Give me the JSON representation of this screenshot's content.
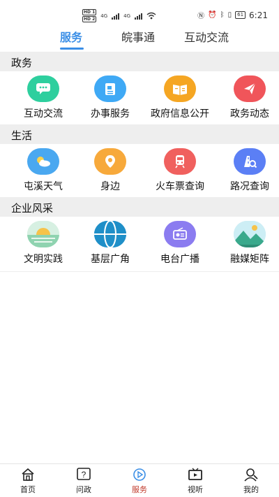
{
  "status_bar": {
    "sim1": "HD 1",
    "sim2": "HD 2",
    "net1": "4G",
    "net2": "4G",
    "battery": "61",
    "time": "6:21"
  },
  "top_tabs": [
    {
      "label": "服务",
      "active": true
    },
    {
      "label": "皖事通",
      "active": false
    },
    {
      "label": "互动交流",
      "active": false
    }
  ],
  "sections": [
    {
      "title": "政务",
      "items": [
        {
          "label": "互动交流",
          "icon": "chat-icon",
          "color": "#2ecf9e"
        },
        {
          "label": "办事服务",
          "icon": "document-icon",
          "color": "#3fa9f5"
        },
        {
          "label": "政府信息公开",
          "icon": "open-book-icon",
          "color": "#f5a623"
        },
        {
          "label": "政务动态",
          "icon": "paper-plane-icon",
          "color": "#f0555a"
        }
      ]
    },
    {
      "title": "生活",
      "items": [
        {
          "label": "屯溪天气",
          "icon": "weather-icon",
          "color": "#4aa8f0"
        },
        {
          "label": "身边",
          "icon": "location-pin-icon",
          "color": "#f7a93b"
        },
        {
          "label": "火车票查询",
          "icon": "train-icon",
          "color": "#f0605e"
        },
        {
          "label": "路况查询",
          "icon": "road-search-icon",
          "color": "#5b7ff5"
        }
      ]
    },
    {
      "title": "企业风采",
      "items": [
        {
          "label": "文明实践",
          "icon": "sunrise-icon",
          "color": "#8fd3b0"
        },
        {
          "label": "基层广角",
          "icon": "globe-icon",
          "color": "#1f8fc8"
        },
        {
          "label": "电台广播",
          "icon": "radio-icon",
          "color": "#8b7cf0"
        },
        {
          "label": "融媒矩阵",
          "icon": "mountain-icon",
          "color": "#6fc4d8"
        }
      ]
    }
  ],
  "bottom_nav": [
    {
      "label": "首页",
      "icon": "home-icon",
      "active": false
    },
    {
      "label": "问政",
      "icon": "question-icon",
      "active": false
    },
    {
      "label": "服务",
      "icon": "service-play-icon",
      "active": true
    },
    {
      "label": "视听",
      "icon": "tv-icon",
      "active": false
    },
    {
      "label": "我的",
      "icon": "user-icon",
      "active": false
    }
  ],
  "colors": {
    "accent": "#3a8ee6",
    "nav_active": "#c0392b",
    "section_bg": "#eeeeee"
  }
}
